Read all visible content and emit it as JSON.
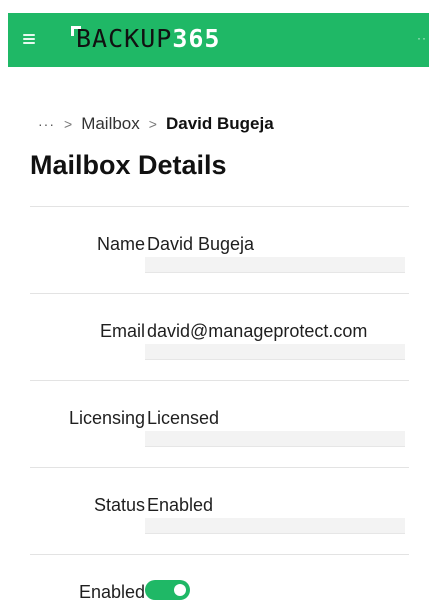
{
  "header": {
    "logo_word": "BACKUP",
    "logo_number": "365",
    "menu_icon": "hamburger-menu-icon",
    "more_icon": "more-dots-icon",
    "bar_color": "#1fb866"
  },
  "breadcrumb": {
    "overflow": "···",
    "separator": ">",
    "items": [
      "Mailbox",
      "David Bugeja"
    ]
  },
  "page_title": "Mailbox Details",
  "fields": [
    {
      "label": "Name",
      "value": "David Bugeja"
    },
    {
      "label": "Email",
      "value": "david@manageprotect.com"
    },
    {
      "label": "Licensing",
      "value": "Licensed"
    },
    {
      "label": "Status",
      "value": "Enabled"
    }
  ],
  "enabled": {
    "label": "Enabled",
    "state": true,
    "toggle_color": "#1fb866"
  }
}
